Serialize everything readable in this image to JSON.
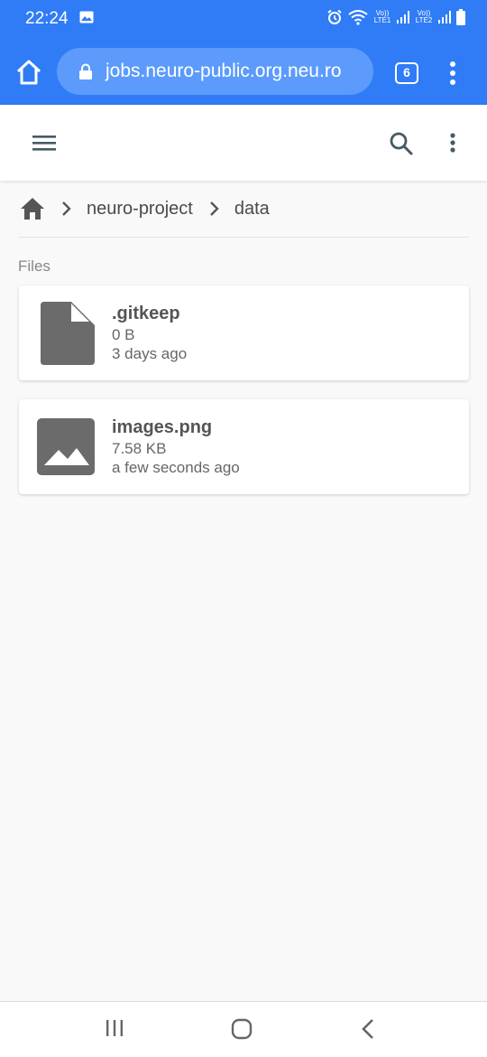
{
  "status_bar": {
    "time": "22:24",
    "sim1": "Vo)) LTE1",
    "sim2": "Vo)) LTE2"
  },
  "browser": {
    "url": "jobs.neuro-public.org.neu.ro",
    "tab_count": "6",
    "accent_color": "#2f7cf6"
  },
  "breadcrumb": {
    "items": [
      "neuro-project",
      "data"
    ]
  },
  "files": {
    "section_label": "Files",
    "items": [
      {
        "name": ".gitkeep",
        "size": "0 B",
        "modified": "3 days ago",
        "icon": "file-icon"
      },
      {
        "name": "images.png",
        "size": "7.58 KB",
        "modified": "a few seconds ago",
        "icon": "image-icon"
      }
    ]
  }
}
